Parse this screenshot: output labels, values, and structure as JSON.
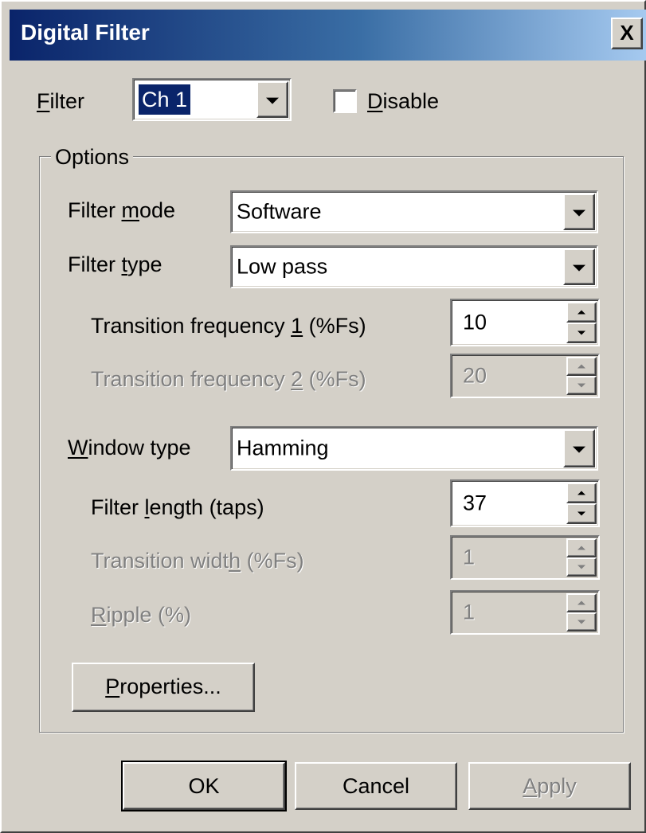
{
  "window": {
    "title": "Digital Filter",
    "close_glyph": "X"
  },
  "filter_row": {
    "label": "Filter",
    "label_access_key": "F",
    "selected_channel": "Ch 1",
    "disable_label": "Disable",
    "disable_access_key": "D",
    "disable_checked": false
  },
  "options": {
    "group_label": "Options",
    "filter_mode": {
      "label_pre": "Filter ",
      "label_key": "m",
      "label_post": "ode",
      "value": "Software"
    },
    "filter_type": {
      "label_pre": "Filter ",
      "label_key": "t",
      "label_post": "ype",
      "value": "Low pass"
    },
    "transition_freq_1": {
      "label_pre": "Transition frequency ",
      "label_key": "1",
      "label_post": " (%Fs)",
      "value": "10",
      "enabled": true
    },
    "transition_freq_2": {
      "label_pre": "Transition frequency ",
      "label_key": "2",
      "label_post": " (%Fs)",
      "value": "20",
      "enabled": false
    },
    "window_type": {
      "label_pre": "",
      "label_key": "W",
      "label_post": "indow type",
      "value": "Hamming"
    },
    "filter_length": {
      "label_pre": "Filter ",
      "label_key": "l",
      "label_post": "ength (taps)",
      "value": "37",
      "enabled": true
    },
    "transition_width": {
      "label_pre": "Transition widt",
      "label_key": "h",
      "label_post": " (%Fs)",
      "value": "1",
      "enabled": false
    },
    "ripple": {
      "label_pre": "",
      "label_key": "R",
      "label_post": "ipple (%)",
      "value": "1",
      "enabled": false
    },
    "properties_button": {
      "label_key": "P",
      "label_post": "roperties..."
    }
  },
  "footer": {
    "ok_label": "OK",
    "cancel_label": "Cancel",
    "apply_key": "A",
    "apply_post": "pply",
    "apply_enabled": false
  },
  "colors": {
    "face": "#d4d0c8",
    "title_start": "#0a246a",
    "title_end": "#a6caf0",
    "selection": "#0a246a",
    "disabled_text": "#808080"
  },
  "icons": {
    "dropdown": "chevron-down-icon",
    "spin_up": "spin-up-icon",
    "spin_down": "spin-down-icon",
    "close": "close-icon"
  }
}
